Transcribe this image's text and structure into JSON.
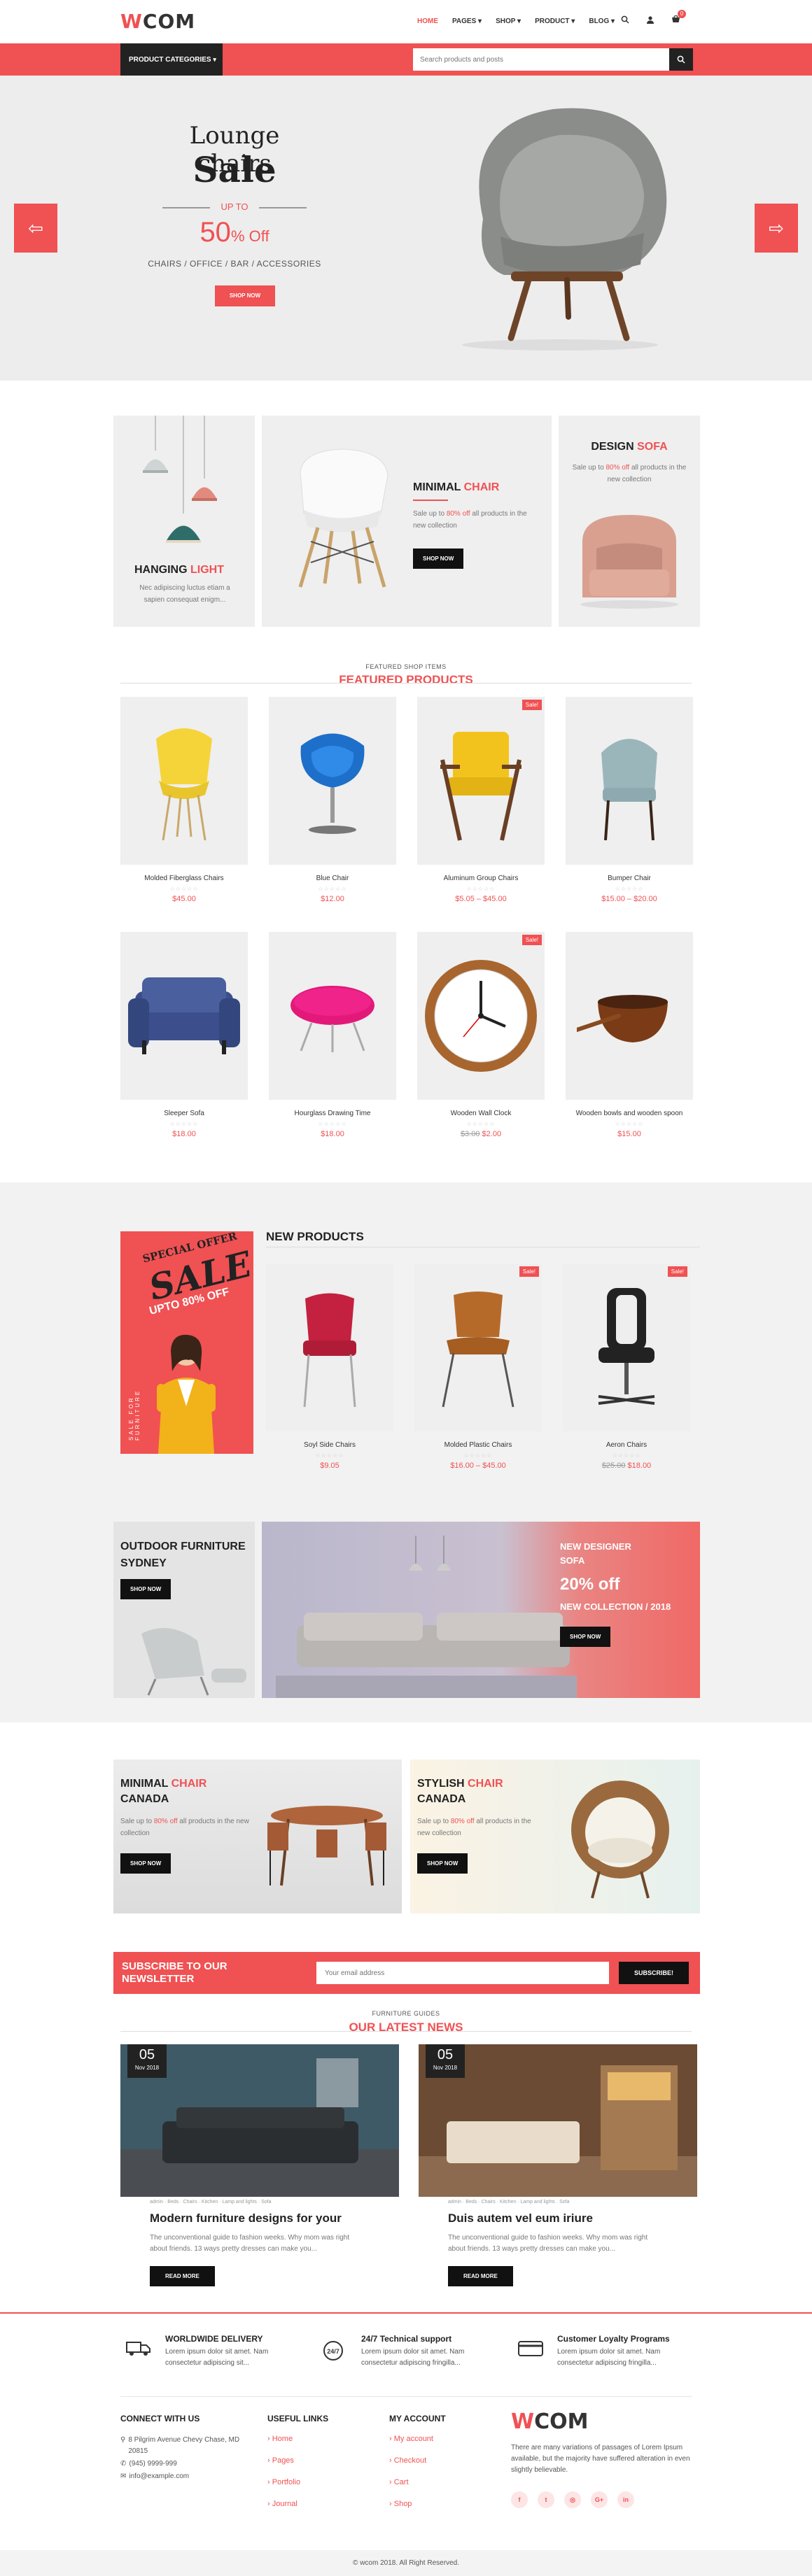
{
  "header": {
    "logo_w": "W",
    "logo_rest": "COM",
    "nav": [
      "HOME",
      "PAGES",
      "SHOP",
      "PRODUCT",
      "BLOG"
    ],
    "cart_count": "0"
  },
  "catbar": {
    "categories_label": "PRODUCT CATEGORIES",
    "search_placeholder": "Search products and posts"
  },
  "hero": {
    "line1": "Lounge chairs",
    "line2": "Sale",
    "upto": "UP TO",
    "percent": "50",
    "percent_suffix": "% Off",
    "categories": "CHAIRS / OFFICE / BAR / ACCESSORIES",
    "button": "SHOP NOW"
  },
  "banners": {
    "hanging": {
      "title1": "HANGING",
      "title2": "LIGHT",
      "text": "Nec adipiscing luctus etiam a sapien consequat enigm..."
    },
    "minimal": {
      "title1": "MINIMAL",
      "title2": "CHAIR",
      "text_pre": "Sale up to ",
      "text_hl": "80% off",
      "text_post": " all products in the new collection",
      "button": "SHOP NOW"
    },
    "design": {
      "title1": "DESIGN",
      "title2": "SOFA",
      "text_pre": "Sale up to ",
      "text_hl": "80% off",
      "text_post": " all products in the new collection"
    }
  },
  "featured": {
    "subtitle": "FEATURED SHOP ITEMS",
    "title": "FEATURED PRODUCTS",
    "products": [
      {
        "name": "Molded Fiberglass Chairs",
        "price": "$45.00",
        "old": "",
        "sale": false
      },
      {
        "name": "Blue Chair",
        "price": "$12.00",
        "old": "",
        "sale": false
      },
      {
        "name": "Aluminum Group Chairs",
        "price": "$5.05 – $45.00",
        "old": "",
        "sale": true
      },
      {
        "name": "Bumper Chair",
        "price": "$15.00 – $20.00",
        "old": "",
        "sale": false
      },
      {
        "name": "Sleeper Sofa",
        "price": "$18.00",
        "old": "",
        "sale": false
      },
      {
        "name": "Hourglass Drawing Time",
        "price": "$18.00",
        "old": "",
        "sale": false
      },
      {
        "name": "Wooden Wall Clock",
        "price": "$2.00",
        "old": "$3.00",
        "sale": true
      },
      {
        "name": "Wooden bowls and wooden spoon",
        "price": "$15.00",
        "old": "",
        "sale": false
      }
    ],
    "sale_label": "Sale!",
    "stars": "☆☆☆☆☆"
  },
  "newsec": {
    "promo_special": "SPECIAL OFFER",
    "promo_sale": "SALE",
    "promo_upto": "UPTO 80% OFF",
    "promo_side": "SALE FOR FURNITURE",
    "title": "NEW PRODUCTS",
    "products": [
      {
        "name": "Soyl Side Chairs",
        "price": "$9.05",
        "old": "",
        "sale": false
      },
      {
        "name": "Molded Plastic Chairs",
        "price": "$16.00 – $45.00",
        "old": "",
        "sale": true
      },
      {
        "name": "Aeron Chairs",
        "price": "$18.00",
        "old": "$25.00",
        "sale": true
      }
    ]
  },
  "outdoor": {
    "title": "OUTDOOR FURNITURE SYDNEY",
    "button": "SHOP NOW"
  },
  "designer": {
    "line1": "NEW DESIGNER",
    "line2": "SOFA",
    "line3": "20% off",
    "line4": "NEW COLLECTION / 2018",
    "button": "SHOP NOW"
  },
  "canada": {
    "left": {
      "title1": "MINIMAL",
      "title2": "CHAIR",
      "title3": "CANADA",
      "text_pre": "Sale up to ",
      "text_hl": "80% off",
      "text_post": " all products in the new collection",
      "button": "SHOP NOW"
    },
    "right": {
      "title1": "STYLISH",
      "title2": "CHAIR",
      "title3": "CANADA",
      "text_pre": "Sale up to ",
      "text_hl": "80% off",
      "text_post": " all products in the new collection",
      "button": "SHOP NOW"
    }
  },
  "newsletter": {
    "title": "SUBSCRIBE TO OUR NEWSLETTER",
    "placeholder": "Your email address",
    "button": "SUBSCRIBE!"
  },
  "news": {
    "subtitle": "FURNITURE GUIDES",
    "title": "OUR LATEST NEWS",
    "posts": [
      {
        "day": "05",
        "month": "Nov 2018",
        "meta": "admin · Beds · Chairs · Kitchen · Lamp and lights · Sofa",
        "title": "Modern furniture designs for your",
        "excerpt": "The unconventional guide to fashion weeks. Why mom was right about friends. 13 ways pretty dresses can make you...",
        "button": "READ MORE"
      },
      {
        "day": "05",
        "month": "Nov 2018",
        "meta": "admin · Beds · Chairs · Kitchen · Lamp and lights · Sofa",
        "title": "Duis autem vel eum iriure",
        "excerpt": "The unconventional guide to fashion weeks. Why mom was right about friends. 13 ways pretty dresses can make you...",
        "button": "READ MORE"
      }
    ]
  },
  "services": [
    {
      "title": "WORLDWIDE DELIVERY",
      "text": "Lorem ipsum dolor sit amet. Nam consectetur adipiscing sit..."
    },
    {
      "title": "24/7 Technical support",
      "text": "Lorem ipsum dolor sit amet. Nam consectetur adipiscing fringilla..."
    },
    {
      "title": "Customer Loyalty Programs",
      "text": "Lorem ipsum dolor sit amet. Nam consectetur adipiscing fringilla..."
    }
  ],
  "footer": {
    "connect_title": "CONNECT WITH US",
    "address": "8 Pilgrim Avenue Chevy Chase, MD 20815",
    "phone": "(945) 9999-999",
    "email": "info@example.com",
    "useful_title": "USEFUL LINKS",
    "useful_links": [
      "Home",
      "Pages",
      "Portfolio",
      "Journal"
    ],
    "account_title": "MY ACCOUNT",
    "account_links": [
      "My account",
      "Checkout",
      "Cart",
      "Shop"
    ],
    "about": "There are many variations of passages of Lorem Ipsum available, but the majority have suffered alteration in even slightly believable.",
    "copyright": "© wcom 2018. All Right Reserved."
  }
}
